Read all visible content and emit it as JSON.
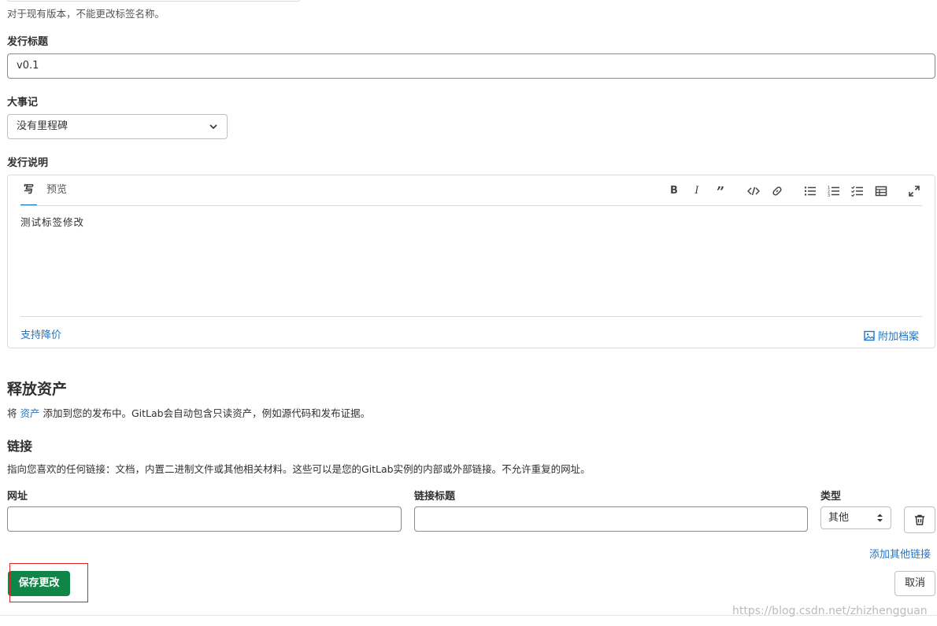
{
  "tag_help": "对于现有版本，不能更改标签名称。",
  "release_title": {
    "label": "发行标题",
    "value": "v0.1"
  },
  "milestone": {
    "label": "大事记",
    "value": "没有里程碑"
  },
  "release_notes": {
    "label": "发行说明",
    "tabs": [
      "写",
      "预览"
    ],
    "content": "测试标签修改",
    "markdown_link": "支持降价",
    "attach_link": "附加档案",
    "toolbar": [
      "bold",
      "italic",
      "quote",
      "code",
      "link",
      "bullet-list",
      "numbered-list",
      "task-list",
      "table",
      "fullscreen"
    ]
  },
  "assets": {
    "title": "释放资产",
    "desc_prefix": "将",
    "desc_link": "资产",
    "desc_suffix": "添加到您的发布中。GitLab会自动包含只读资产，例如源代码和发布证据。"
  },
  "links": {
    "title": "链接",
    "desc": "指向您喜欢的任何链接：文档，内置二进制文件或其他相关材料。这些可以是您的GitLab实例的内部或外部链接。不允许重复的网址。",
    "url_label": "网址",
    "url_value": "",
    "link_title_label": "链接标题",
    "link_title_value": "",
    "type_label": "类型",
    "type_value": "其他",
    "add_more": "添加其他链接"
  },
  "actions": {
    "save": "保存更改",
    "cancel": "取消"
  },
  "watermark": "https://blog.csdn.net/zhizhengguan",
  "colors": {
    "primary_button": "#108548",
    "link": "#1f75cb",
    "highlight_box": "#e02020"
  }
}
